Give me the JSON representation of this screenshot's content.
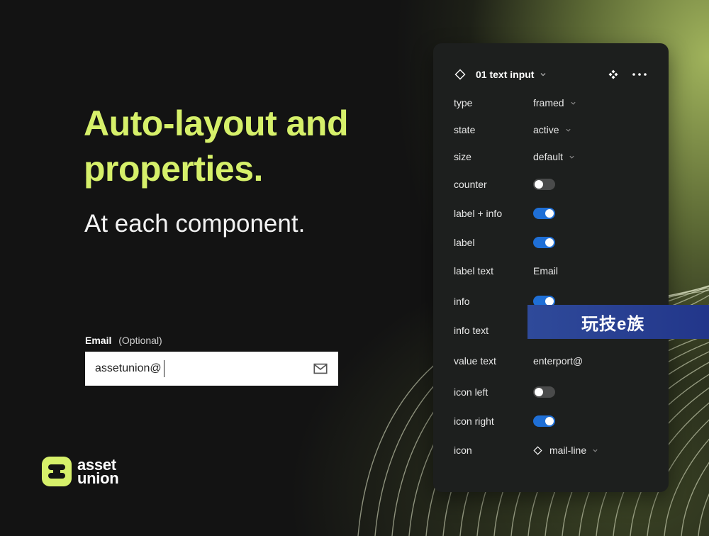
{
  "hero": {
    "title": "Auto-layout and properties.",
    "subtitle": "At each component."
  },
  "email_field": {
    "label": "Email",
    "optional": "(Optional)",
    "value": "assetunion@",
    "icon": "mail-icon"
  },
  "logo": {
    "line1": "asset",
    "line2": "union",
    "color": "#d6f06a"
  },
  "panel": {
    "title": "01 text input",
    "header_icons": [
      "component-diamond-icon",
      "chevron-down-icon",
      "component-instance-icon",
      "more-icon"
    ],
    "props": [
      {
        "name": "type",
        "kind": "dropdown",
        "value": "framed"
      },
      {
        "name": "state",
        "kind": "dropdown",
        "value": "active"
      },
      {
        "name": "size",
        "kind": "dropdown",
        "value": "default"
      },
      {
        "name": "counter",
        "kind": "toggle",
        "value": "off"
      },
      {
        "name": "label + info",
        "kind": "toggle",
        "value": "on"
      },
      {
        "name": "label",
        "kind": "toggle",
        "value": "on"
      },
      {
        "name": "label text",
        "kind": "text",
        "value": "Email"
      },
      {
        "name": "info",
        "kind": "toggle",
        "value": "on"
      },
      {
        "name": "info text",
        "kind": "text",
        "value": ""
      },
      {
        "name": "value text",
        "kind": "text",
        "value": "enterport@"
      },
      {
        "name": "icon left",
        "kind": "toggle",
        "value": "off"
      },
      {
        "name": "icon right",
        "kind": "toggle",
        "value": "on"
      },
      {
        "name": "icon",
        "kind": "instance",
        "value": "mail-line"
      }
    ]
  },
  "watermark": {
    "text": "玩技e族"
  },
  "colors": {
    "accent": "#d6f06a",
    "toggle_on": "#1f6fd6",
    "toggle_off": "#4a4b4b",
    "panel_bg": "#1d1f1e"
  }
}
